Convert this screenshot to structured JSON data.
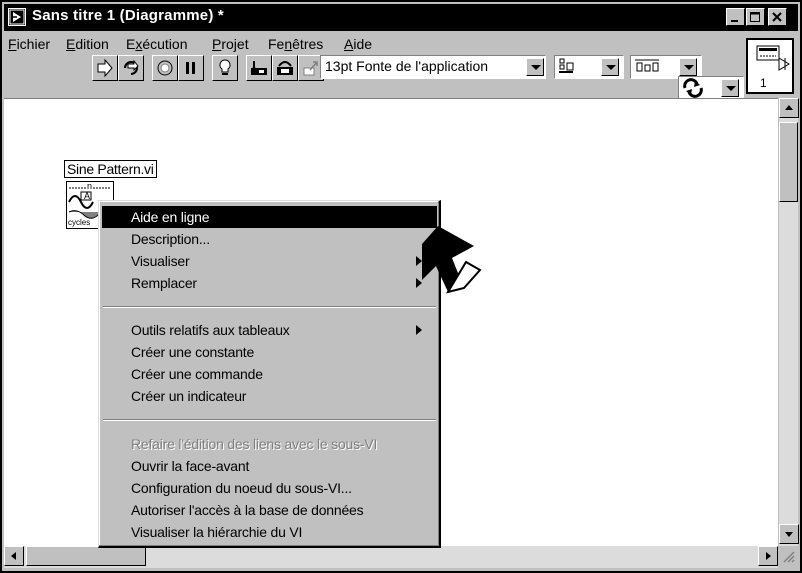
{
  "window": {
    "title": "Sans titre 1 (Diagramme) *"
  },
  "menubar": {
    "items": [
      {
        "label": "Fichier",
        "accel": "F"
      },
      {
        "label": "Edition",
        "accel": "E"
      },
      {
        "label": "Exécution",
        "accel": "x"
      },
      {
        "label": "Projet",
        "accel": "P"
      },
      {
        "label": "Fenêtres",
        "accel": "n"
      },
      {
        "label": "Aide",
        "accel": "A"
      }
    ]
  },
  "toolbar": {
    "font_select": "13pt Fonte de l'application"
  },
  "connector_pane": {
    "number": "1"
  },
  "diagram": {
    "subvi_label": "Sine Pattern.vi",
    "icon_text_n": "n",
    "icon_text_a": "A",
    "icon_text_cycles": "cycles"
  },
  "context_menu": {
    "groups": [
      [
        {
          "label": "Aide en ligne",
          "selected": true
        },
        {
          "label": "Description..."
        },
        {
          "label": "Visualiser",
          "submenu": true
        },
        {
          "label": "Remplacer",
          "submenu": true
        }
      ],
      [
        {
          "label": "Outils relatifs aux tableaux",
          "submenu": true
        },
        {
          "label": "Créer une constante"
        },
        {
          "label": "Créer une commande"
        },
        {
          "label": "Créer un indicateur"
        }
      ],
      [
        {
          "label": "Refaire l'édition des liens avec le sous-VI",
          "disabled": true
        },
        {
          "label": "Ouvrir la face-avant"
        },
        {
          "label": "Configuration du noeud du sous-VI..."
        },
        {
          "label": "Autoriser l'accès à la base de données"
        },
        {
          "label": "Visualiser la hiérarchie du VI"
        }
      ]
    ]
  },
  "icons": {
    "app": "labview-diagram-icon",
    "minimize": "minimize-icon",
    "maximize": "maximize-icon",
    "close": "close-icon",
    "pointer": "arrow-pointer-icon"
  }
}
